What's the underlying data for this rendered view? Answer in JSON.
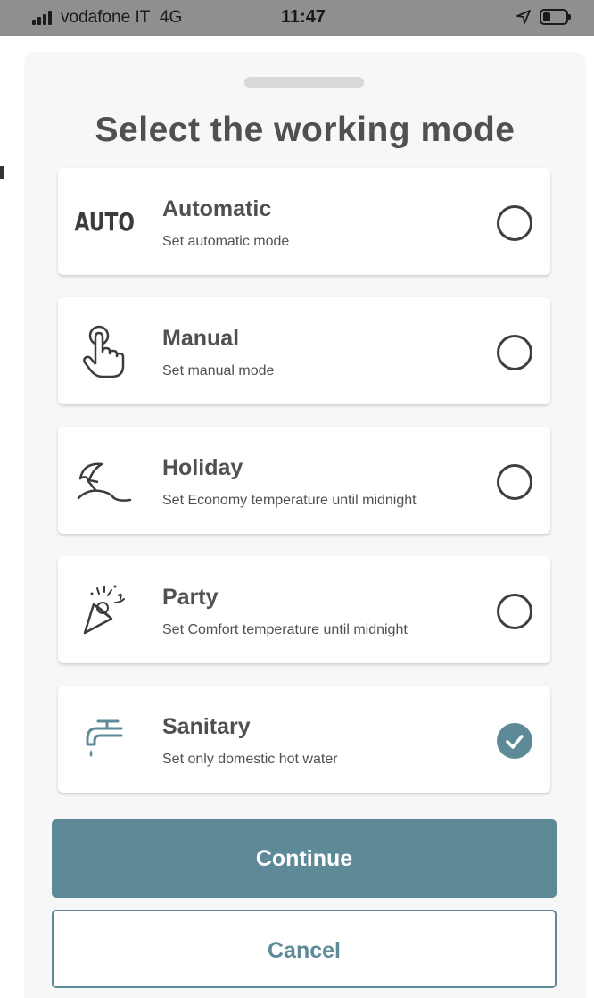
{
  "status_bar": {
    "carrier": "vodafone IT",
    "network": "4G",
    "time": "11:47"
  },
  "sheet": {
    "title": "Select the working mode"
  },
  "options": [
    {
      "name": "Automatic",
      "description": "Set automatic mode",
      "icon": "auto-icon",
      "icon_text": "AUTO",
      "selected": false
    },
    {
      "name": "Manual",
      "description": "Set manual mode",
      "icon": "hand-pointer-icon",
      "selected": false
    },
    {
      "name": "Holiday",
      "description": "Set Economy temperature until midnight",
      "icon": "beach-umbrella-icon",
      "selected": false
    },
    {
      "name": "Party",
      "description": "Set Comfort temperature until midnight",
      "icon": "party-popper-icon",
      "selected": false
    },
    {
      "name": "Sanitary",
      "description": "Set only domestic hot water",
      "icon": "water-tap-icon",
      "selected": true
    }
  ],
  "buttons": {
    "continue": "Continue",
    "cancel": "Cancel"
  },
  "colors": {
    "accent": "#5e8a98",
    "status_bar_bg": "#8f8f8f",
    "text": "#505050"
  }
}
